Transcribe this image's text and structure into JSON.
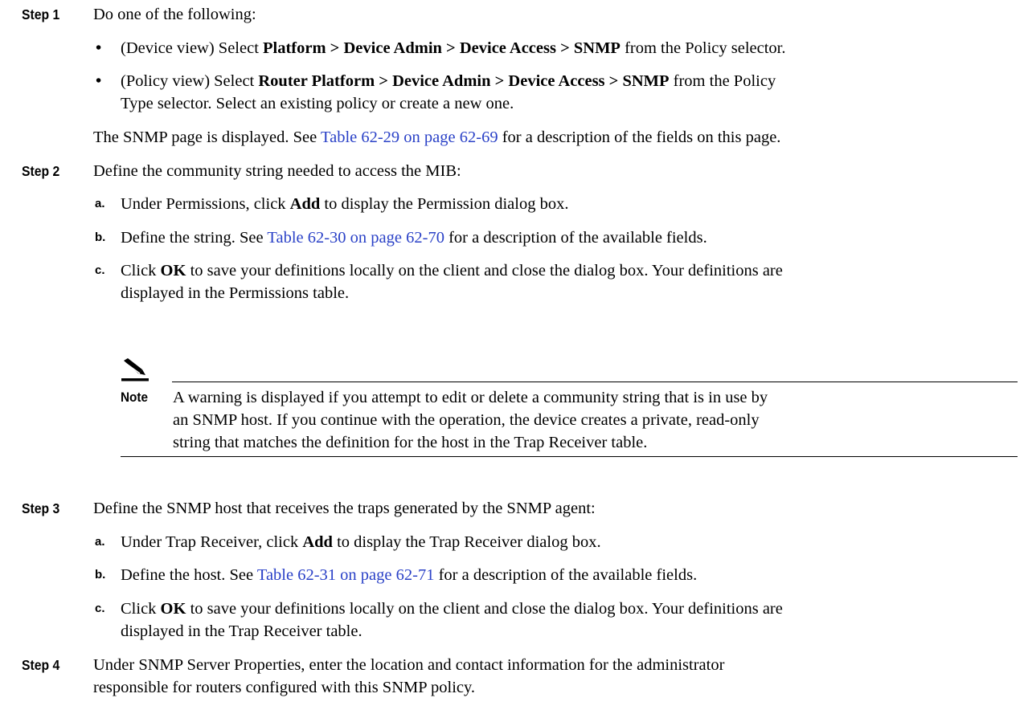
{
  "step1": {
    "label": "Step 1",
    "intro": "Do one of the following:",
    "bullets": [
      {
        "pre": "(Device view) Select ",
        "path": "Platform > Device Admin > Device Access > SNMP",
        "post": " from the Policy selector."
      },
      {
        "pre": "(Policy view) Select ",
        "path": "Router Platform > Device Admin > Device Access > SNMP",
        "post": " from the Policy",
        "line2": "Type selector. Select an existing policy or create a new one."
      }
    ],
    "result": {
      "pre": "The SNMP page is displayed. See ",
      "link": "Table 62-29 on page 62-69",
      "post": " for a description of the fields on this page."
    }
  },
  "step2": {
    "label": "Step 2",
    "intro": "Define the community string needed to access the MIB:",
    "a": {
      "letter": "a.",
      "pre": "Under Permissions, click ",
      "bold": "Add",
      "post": " to display the Permission dialog box."
    },
    "b": {
      "letter": "b.",
      "pre": "Define the string. See ",
      "link": "Table 62-30 on page 62-70",
      "post": " for a description of the available fields."
    },
    "c": {
      "letter": "c.",
      "pre": "Click ",
      "bold": "OK",
      "post": " to save your definitions locally on the client and close the dialog box. Your definitions are",
      "line2": "displayed in the Permissions table."
    },
    "note": {
      "label": "Note",
      "lines": [
        "A warning is displayed if you attempt to edit or delete a community string that is in use by",
        "an SNMP host. If you continue with the operation, the device creates a private, read-only",
        "string that matches the definition for the host in the Trap Receiver table."
      ]
    }
  },
  "step3": {
    "label": "Step 3",
    "intro": "Define the SNMP host that receives the traps generated by the SNMP agent:",
    "a": {
      "letter": "a.",
      "pre": "Under Trap Receiver, click ",
      "bold": "Add",
      "post": " to display the Trap Receiver dialog box."
    },
    "b": {
      "letter": "b.",
      "pre": "Define the host. See ",
      "link": "Table 62-31 on page 62-71",
      "post": " for a description of the available fields."
    },
    "c": {
      "letter": "c.",
      "pre": "Click ",
      "bold": "OK",
      "post": " to save your definitions locally on the client and close the dialog box. Your definitions are",
      "line2": "displayed in the Trap Receiver table."
    }
  },
  "step4": {
    "label": "Step 4",
    "line1": "Under SNMP Server Properties, enter the location and contact information for the administrator",
    "line2": "responsible for routers configured with this SNMP policy."
  }
}
